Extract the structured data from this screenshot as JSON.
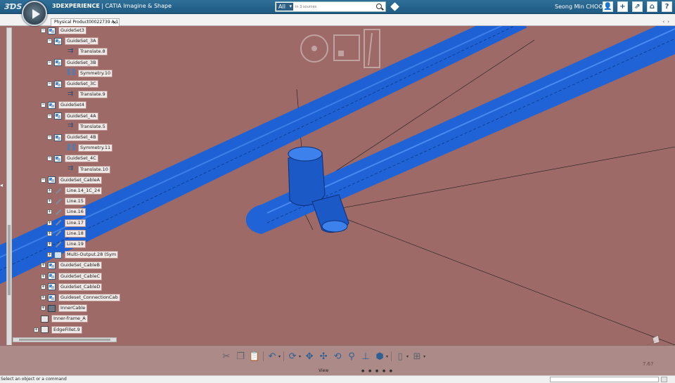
{
  "header": {
    "brand": "3DEXPERIENCE",
    "app_title_rest": " | CATIA Imagine & Shape",
    "search_scope": "All",
    "search_placeholder": "in 3 sources",
    "user": "Seong Min CHOO"
  },
  "tabs": [
    {
      "label": "Physical Product00022739 A.1"
    }
  ],
  "tree": {
    "nodes": [
      {
        "label": "GuideSet3",
        "icon": "set",
        "expander": "−"
      },
      {
        "label": "GuideSet_3A",
        "icon": "set",
        "expander": "−"
      },
      {
        "label": "Translate.8",
        "icon": "translate",
        "expander": ""
      },
      {
        "label": "GuideSet_3B",
        "icon": "set",
        "expander": "−"
      },
      {
        "label": "Symmetry.10",
        "icon": "symmetry",
        "expander": ""
      },
      {
        "label": "GuideSet_3C",
        "icon": "set",
        "expander": "−"
      },
      {
        "label": "Translate.9",
        "icon": "translate",
        "expander": ""
      },
      {
        "label": "GuideSet4",
        "icon": "set",
        "expander": "−"
      },
      {
        "label": "GuideSet_4A",
        "icon": "set",
        "expander": "−"
      },
      {
        "label": "Translate.5",
        "icon": "translate",
        "expander": ""
      },
      {
        "label": "GuideSet_4B",
        "icon": "set",
        "expander": "−"
      },
      {
        "label": "Symmetry.11",
        "icon": "symmetry",
        "expander": ""
      },
      {
        "label": "GuideSet_4C",
        "icon": "set",
        "expander": "−"
      },
      {
        "label": "Translate.10",
        "icon": "translate",
        "expander": ""
      },
      {
        "label": "GuideSet_CableA",
        "icon": "set",
        "expander": "−"
      },
      {
        "label": "Line.14_1C_24",
        "icon": "line",
        "expander": "+"
      },
      {
        "label": "Line.15",
        "icon": "line",
        "expander": "+"
      },
      {
        "label": "Line.16",
        "icon": "line",
        "expander": "+"
      },
      {
        "label": "Line.17",
        "icon": "line",
        "expander": "+"
      },
      {
        "label": "Line.18",
        "icon": "line",
        "expander": "+"
      },
      {
        "label": "Line.19",
        "icon": "line",
        "expander": "+"
      },
      {
        "label": "Multi-Output.28 (Sym",
        "icon": "multi",
        "expander": "+"
      },
      {
        "label": "GuideSet_CableB",
        "icon": "set",
        "expander": "+"
      },
      {
        "label": "GuideSet_CableC",
        "icon": "set",
        "expander": "+"
      },
      {
        "label": "GuideSet_CableD",
        "icon": "set",
        "expander": "+"
      },
      {
        "label": "Guideset_ConnectionCab",
        "icon": "set",
        "expander": "+"
      },
      {
        "label": "InnerCable",
        "icon": "inner",
        "expander": "+"
      },
      {
        "label": "Inner-frame_A",
        "icon": "part",
        "expander": ""
      },
      {
        "label": "EdgeFillet.9",
        "icon": "part",
        "expander": "+"
      }
    ]
  },
  "toolbar": {
    "section_label": "View",
    "icons": [
      "cut-icon",
      "copy-icon",
      "paste-icon",
      "undo-icon",
      "update-icon",
      "fit-all-icon",
      "pan-icon",
      "rotate-icon",
      "zoom-icon",
      "normal-view-icon",
      "iso-view-icon",
      "hide-show-icon",
      "render-style-icon"
    ]
  },
  "viewport": {
    "zoom_readout": "7.67"
  },
  "status": {
    "message": "Select an object or a command"
  },
  "colors": {
    "header_bg": "#2a6690",
    "viewport_bg": "#9d6a67",
    "tube": "#1f63d6",
    "toolbar_bg": "#ac8a87"
  }
}
